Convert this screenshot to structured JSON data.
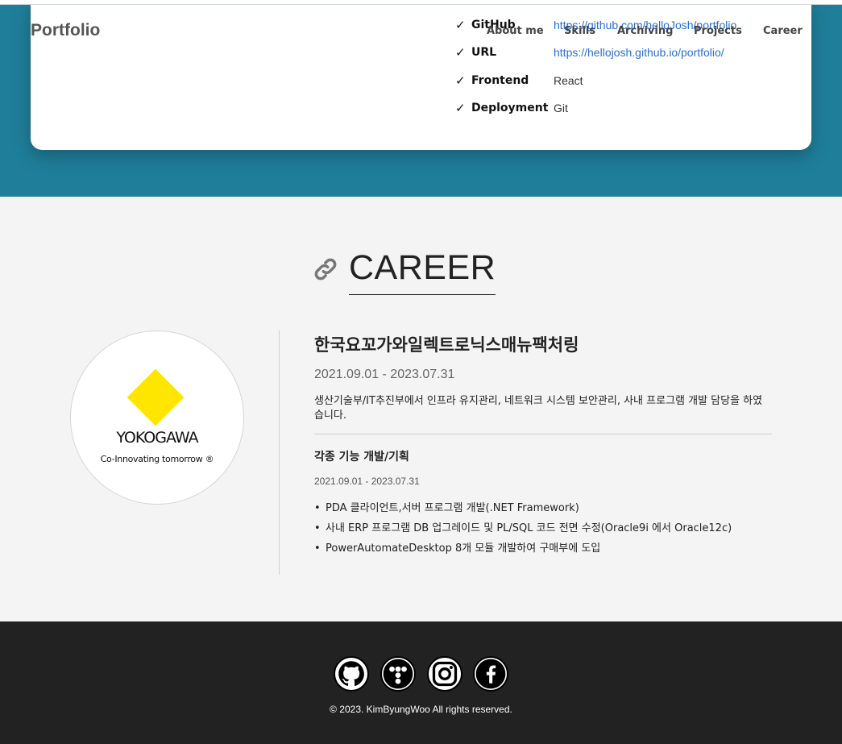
{
  "navbar": {
    "brand": "Portfolio",
    "items": [
      "About me",
      "Skills",
      "Archiving",
      "Projects",
      "Career"
    ]
  },
  "project_info": {
    "check_symbol": "✓",
    "rows": [
      {
        "key": "GitHub",
        "value": "https://github.com/helloJosh/portfolio"
      },
      {
        "key": "URL",
        "value": "https://hellojosh.github.io/portfolio/"
      },
      {
        "key": "Frontend",
        "value": "React"
      },
      {
        "key": "Deployment",
        "value": "Git"
      }
    ]
  },
  "career": {
    "section_title": "CAREER",
    "section_icon": "link-icon",
    "logo": {
      "wordmark": "YOKOGAWA",
      "tagline": "Co-Innovating tomorrow ®"
    },
    "company": "한국요꼬가와일렉트로닉스매뉴팩처링",
    "period": "2021.09.01 - 2023.07.31",
    "description": "생산기술부/IT추진부에서 인프라 유지관리, 네트워크 시스템 보안관리, 사내 프로그램 개발 담당을 하였습니다.",
    "project": {
      "title": "각종 기능 개발/기획",
      "period": "2021.09.01 - 2023.07.31",
      "tasks": [
        "PDA 클라이언트,서버 프로그램 개발(.NET Framework)",
        "사내 ERP 프로그램 DB 업그레이드 및 PL/SQL 코드 전면 수정(Oracle9i 에서 Oracle12c)",
        "PowerAutomateDesktop 8개 모듈 개발하여 구매부에 도입"
      ]
    }
  },
  "footer": {
    "social_icons": [
      "github-icon",
      "tistory-icon",
      "instagram-icon",
      "facebook-icon"
    ],
    "copyright": "© 2023. KimByungWoo All rights reserved."
  },
  "colors": {
    "teal": "#1f7e9a",
    "link": "#2a6fd6",
    "footer_bg": "#222222",
    "yokogawa_yellow": "#ffe600"
  }
}
